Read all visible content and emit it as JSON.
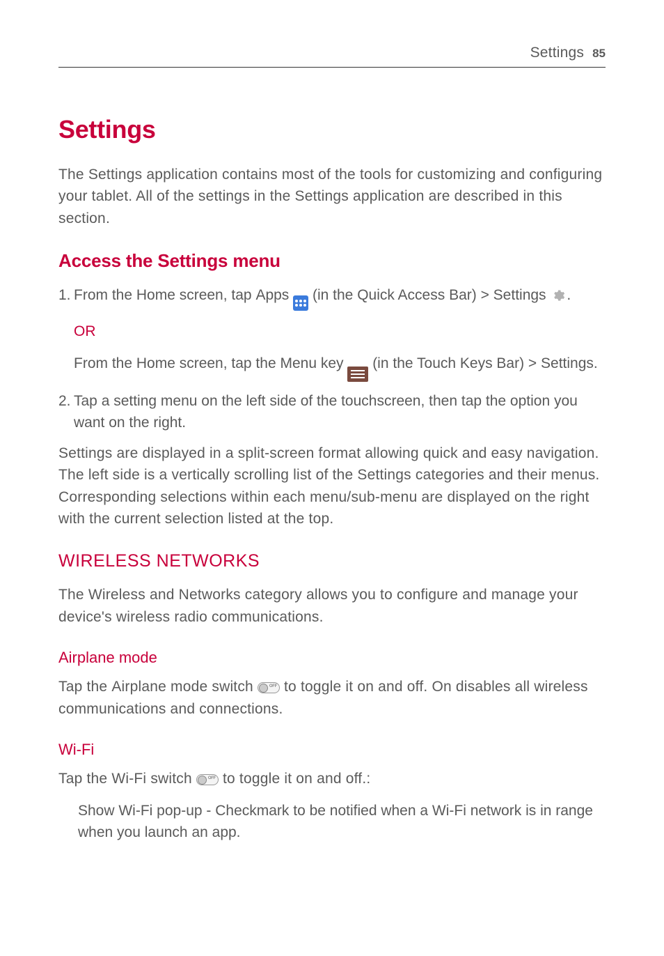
{
  "header": {
    "section": "Settings",
    "page_number": "85"
  },
  "title": "Settings",
  "intro": {
    "prefix": "The ",
    "bold": "Settings",
    "suffix": " application contains most of the tools for customizing and configuring your tablet. All of the settings in the Settings application are described in this section."
  },
  "access": {
    "heading": "Access the Settings menu",
    "step1": {
      "num": "1.",
      "t1": "From the Home screen, tap ",
      "apps": "Apps",
      "t2": " (in the Quick Access Bar) > ",
      "settings": "Settings",
      "period": ".",
      "or": "OR",
      "alt_t1": "From the Home screen, tap the ",
      "menu_key": "Menu key",
      "alt_t2": " (in the Touch Keys Bar) > ",
      "alt_settings": "Settings",
      "alt_period": "."
    },
    "step2": {
      "num": "2.",
      "text": "Tap a setting menu on the left side of the touchscreen, then tap the option you want on the right."
    },
    "split_para": "Settings are displayed in a split-screen format allowing quick and easy navigation. The left side is a vertically scrolling list of the Settings categories and their menus. Corresponding selections within each menu/sub-menu are displayed on the right with the current selection listed at the top."
  },
  "wireless": {
    "heading": "WIRELESS NETWORKS",
    "intro": "The Wireless and Networks category allows you to configure and manage your device's wireless radio communications.",
    "airplane": {
      "heading": "Airplane mode",
      "t1": "Tap the ",
      "bold": "Airplane mode",
      "t2": " switch ",
      "t3": " to toggle it on and off. On disables all wireless communications and connections."
    },
    "wifi": {
      "heading": "Wi-Fi",
      "t1": "Tap the ",
      "bold": "Wi-Fi",
      "t2": " switch ",
      "t3": " to toggle it on and off.:",
      "sub_bold": "Show Wi-Fi pop-up",
      "sub_text": " - Checkmark to be notified when a Wi-Fi network is in range when you launch an app."
    }
  },
  "toggle_label": "OFF"
}
